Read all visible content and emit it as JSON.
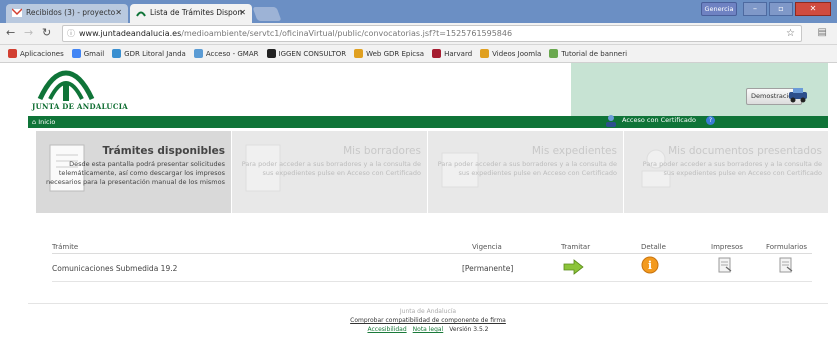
{
  "browser": {
    "tabs": [
      {
        "title": "Recibidos (3) - proyecto"
      },
      {
        "title": "Lista de Trámites Dispon"
      }
    ],
    "user_button": "Genercia",
    "url": {
      "domain": "www.juntadeandalucia.es",
      "path": "/medioambiente/servtc1/oficinaVirtual/public/convocatorias.jsf?t=1525761595846"
    },
    "bookmarks": [
      {
        "label": "Aplicaciones",
        "icon": "apps-grid-icon",
        "color": "#d23f31"
      },
      {
        "label": "Gmail",
        "icon": "google-icon",
        "color": "#4285f4"
      },
      {
        "label": "GDR Litoral Janda",
        "icon": "gdr-icon",
        "color": "#3a8fd0"
      },
      {
        "label": "Acceso - GMAR",
        "icon": "gmar-icon",
        "color": "#5a9bd4"
      },
      {
        "label": "IGGEN CONSULTOR",
        "icon": "iggen-icon",
        "color": "#222222"
      },
      {
        "label": "Web GDR Epicsa",
        "icon": "epicsa-icon",
        "color": "#e0a020"
      },
      {
        "label": "Harvard",
        "icon": "harvard-icon",
        "color": "#a51c30"
      },
      {
        "label": "Videos Joomla",
        "icon": "joomla-icon",
        "color": "#e0a020"
      },
      {
        "label": "Tutorial de banneri",
        "icon": "tutorial-icon",
        "color": "#6aa84f"
      }
    ]
  },
  "site": {
    "logo_text": "JUNTA DE ANDALUCIA",
    "demo_button": "Demostración",
    "nav_home": "Inicio",
    "cert_access": "Acceso con Certificado",
    "cert_help": "?"
  },
  "cards": [
    {
      "title": "Trámites disponibles",
      "desc": "Desde esta pantalla podrá presentar solicitudes telemáticamente, así como descargar los impresos necesarios para la presentación manual de los mismos",
      "active": true
    },
    {
      "title": "Mis borradores",
      "desc": "Para poder acceder a sus borradores y a la consulta de sus expedientes pulse en Acceso con Certificado",
      "active": false
    },
    {
      "title": "Mis expedientes",
      "desc": "Para poder acceder a sus borradores y a la consulta de sus expedientes pulse en Acceso con Certificado",
      "active": false
    },
    {
      "title": "Mis documentos presentados",
      "desc": "Para poder acceder a sus borradores y a la consulta de sus expedientes pulse en Acceso con Certificado",
      "active": false
    }
  ],
  "table": {
    "headers": {
      "tramite": "Trámite",
      "vigencia": "Vigencia",
      "tramitar": "Tramitar",
      "detalle": "Detalle",
      "impresos": "Impresos",
      "formularios": "Formularios"
    },
    "rows": [
      {
        "tramite": "Comunicaciones Submedida 19.2",
        "vigencia": "[Permanente]"
      }
    ]
  },
  "footer": {
    "org": "Junta de Andalucía",
    "compat": "Comprobar compatibilidad de componente de firma",
    "accesibilidad": "Accesibilidad",
    "nota_legal": "Nota legal",
    "version": "Versión 3.5.2"
  },
  "colors": {
    "brand_green": "#0f7438",
    "demo_panel": "#c7e3d3"
  }
}
